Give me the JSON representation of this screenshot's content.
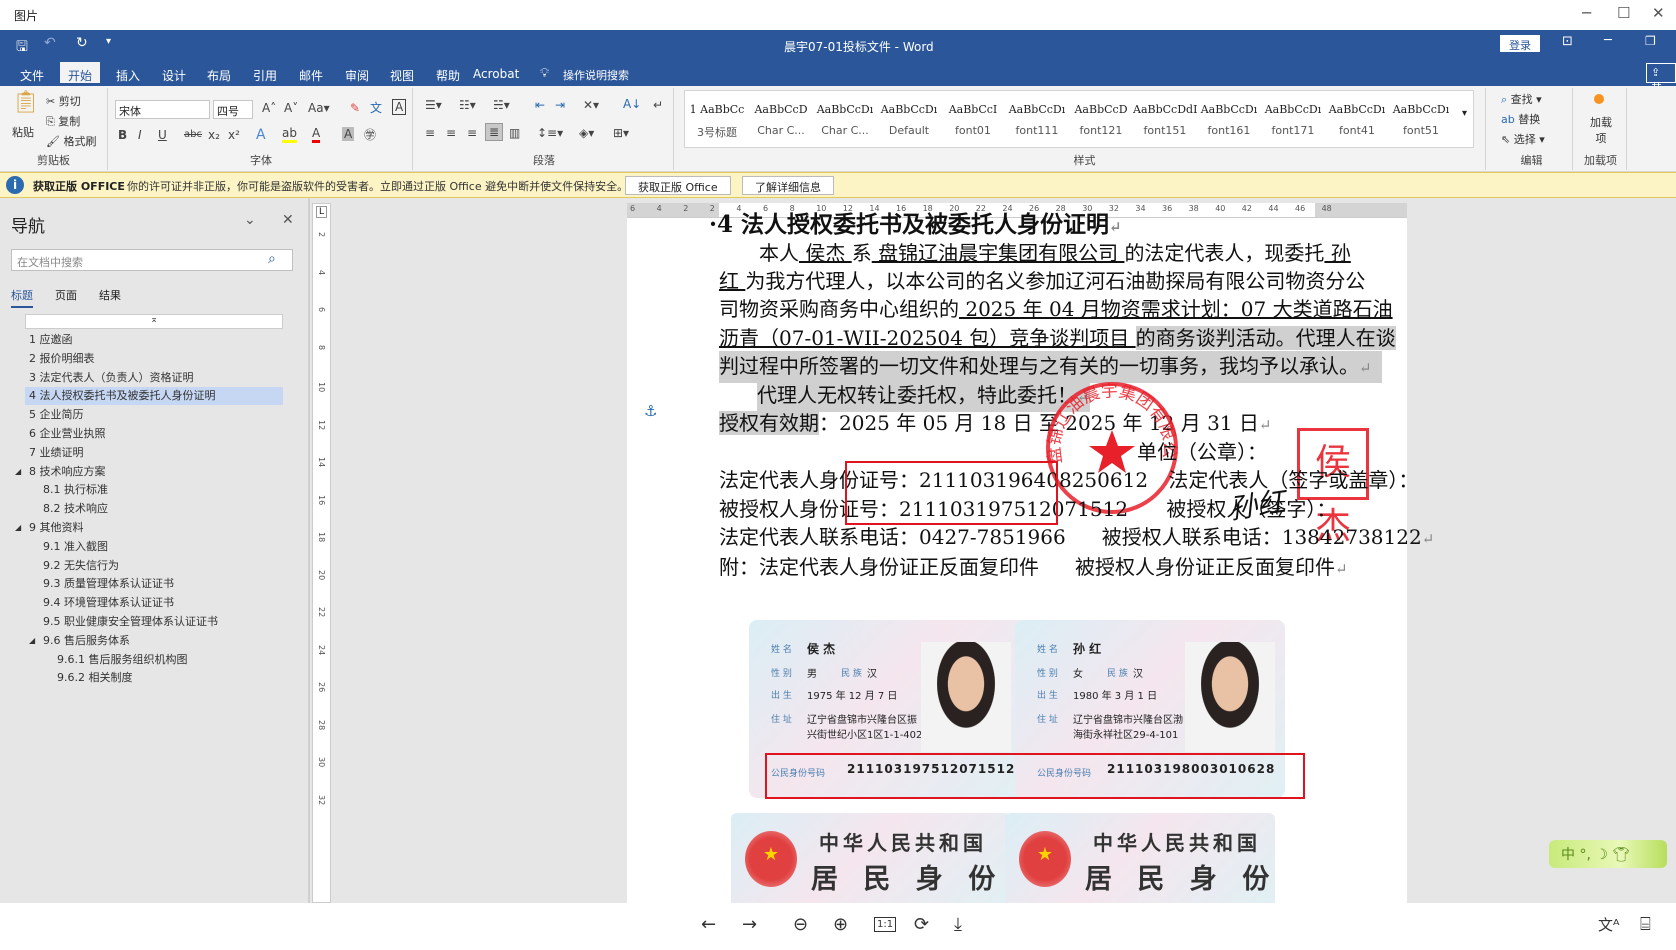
{
  "viewer": {
    "title": "图片",
    "bottom_icons": [
      "arrow-left-icon",
      "arrow-right-icon",
      "zoom-out-icon",
      "zoom-in-icon",
      "actual-size-icon",
      "rotate-icon",
      "download-icon",
      "translate-icon",
      "ocr-icon"
    ],
    "actual_size_label": "1:1"
  },
  "word": {
    "title": "晨宇07-01投标文件  -  Word",
    "login": "登录",
    "share": "共"
  },
  "menu": {
    "tabs": [
      "文件",
      "开始",
      "插入",
      "设计",
      "布局",
      "引用",
      "邮件",
      "审阅",
      "视图",
      "帮助",
      "Acrobat"
    ],
    "active": "开始",
    "tell_me": "操作说明搜索"
  },
  "ribbon": {
    "clipboard": {
      "paste": "粘贴",
      "cut": "剪切",
      "copy": "复制",
      "format_painter": "格式刷",
      "label": "剪贴板"
    },
    "font": {
      "name": "宋体",
      "size": "四号",
      "label": "字体",
      "buttons": [
        "B",
        "I",
        "U",
        "abc",
        "x₂",
        "x²"
      ]
    },
    "paragraph": {
      "label": "段落"
    },
    "styles": {
      "label": "样式",
      "items": [
        {
          "preview": "1  AaBbCc",
          "name": "3号标题"
        },
        {
          "preview": "AaBbCcD",
          "name": "Char C..."
        },
        {
          "preview": "AaBbCcDı",
          "name": "Char C..."
        },
        {
          "preview": "AaBbCcDı",
          "name": "Default"
        },
        {
          "preview": "AaBbCcI",
          "name": "font01"
        },
        {
          "preview": "AaBbCcDı",
          "name": "font111"
        },
        {
          "preview": "AaBbCcD",
          "name": "font121"
        },
        {
          "preview": "AaBbCcDdI",
          "name": "font151"
        },
        {
          "preview": "AaBbCcDı",
          "name": "font161"
        },
        {
          "preview": "AaBbCcDı",
          "name": "font171"
        },
        {
          "preview": "AaBbCcDı",
          "name": "font41"
        },
        {
          "preview": "AaBbCcDı",
          "name": "font51"
        }
      ]
    },
    "editing": {
      "find": "查找",
      "replace": "替换",
      "select": "选择",
      "label": "编辑"
    },
    "addins": {
      "button": "加载项",
      "label": "加载项"
    }
  },
  "notice": {
    "title": "获取正版 OFFICE",
    "message": "你的许可证并非正版，你可能是盗版软件的受害者。立即通过正版 Office 避免中断并使文件保持安全。",
    "btn_get": "获取正版 Office",
    "btn_learn": "了解详细信息"
  },
  "nav": {
    "title": "导航",
    "search_placeholder": "在文档中搜索",
    "tabs": [
      "标题",
      "页面",
      "结果"
    ],
    "items": [
      {
        "t": "1 应邀函",
        "l": 0
      },
      {
        "t": "2 报价明细表",
        "l": 0
      },
      {
        "t": "3 法定代表人（负责人）资格证明",
        "l": 0
      },
      {
        "t": "4 法人授权委托书及被委托人身份证明",
        "l": 0,
        "sel": true
      },
      {
        "t": "5 企业简历",
        "l": 0
      },
      {
        "t": "6 企业营业执照",
        "l": 0
      },
      {
        "t": "7 业绩证明",
        "l": 0
      },
      {
        "t": "8 技术响应方案",
        "l": 0,
        "exp": true
      },
      {
        "t": "8.1 执行标准",
        "l": 1
      },
      {
        "t": "8.2 技术响应",
        "l": 1
      },
      {
        "t": "9 其他资料",
        "l": 0,
        "exp": true
      },
      {
        "t": "9.1 准入截图",
        "l": 1
      },
      {
        "t": "9.2 无失信行为",
        "l": 1
      },
      {
        "t": "9.3 质量管理体系认证证书",
        "l": 1
      },
      {
        "t": "9.4 环境管理体系认证证书",
        "l": 1
      },
      {
        "t": "9.5 职业健康安全管理体系认证证书",
        "l": 1
      },
      {
        "t": "9.6 售后服务体系",
        "l": 1,
        "exp": true
      },
      {
        "t": "9.6.1 售后服务组织机构图",
        "l": 2
      },
      {
        "t": "9.6.2 相关制度",
        "l": 2
      }
    ]
  },
  "rulers": {
    "h": [
      "6",
      "4",
      "2",
      "2",
      "4",
      "6",
      "8",
      "10",
      "12",
      "14",
      "16",
      "18",
      "20",
      "22",
      "24",
      "26",
      "28",
      "30",
      "32",
      "34",
      "36",
      "38",
      "40",
      "42",
      "44",
      "46",
      "48"
    ],
    "v": [
      "2",
      "4",
      "6",
      "8",
      "10",
      "12",
      "14",
      "16",
      "18",
      "20",
      "22",
      "24",
      "26",
      "28",
      "30",
      "32"
    ]
  },
  "doc": {
    "heading": "4  法人授权委托书及被委托人身份证明",
    "p1a": "本人",
    "rep": " 侯杰 ",
    "p1b": "系",
    "company": " 盘锦辽油晨宇集团有限公司 ",
    "p1c": "的法定代表人，现委托",
    "agent1": " 孙",
    "agent2": "红 ",
    "p2": "为我方代理人，以本公司的名义参加辽河石油勘探局有限公司物资分公",
    "p3a": "司物资采购商务中心组织的",
    "proj1": " 2025 年 04 月物资需求计划：07 大类道路石油",
    "proj2": "沥青（07-01-WII-202504 包）竞争谈判项目 ",
    "p4": "的商务谈判活动。代理人在谈",
    "p5": "判过程中所签署的一切文件和处理与之有关的一切事务，我均予以承认。",
    "p6": "代理人无权转让委托权，特此委托！",
    "valid_label": "授权有效期",
    "valid": "：2025 年 05 月 18 日  至  2025 年 12 月 31 日",
    "unit": "单位（公章）：",
    "rep_id": "法定代表人身份证号：211103196408250612",
    "rep_sign": "法定代表人（签字或盖章）：",
    "agent_id": "被授权人身份证号：211103197512071512",
    "agent_sign": "被授权人（签字）：",
    "rep_tel": "法定代表人联系电话：0427-7851966",
    "agent_tel": "被授权人联系电话：13842738122",
    "att_rep": "附：法定代表人身份证正反面复印件",
    "att_agent": "被授权人身份证正反面复印件",
    "seal_text": "盘锦辽油晨宇集团有限公司",
    "square_seal": "侯杰",
    "signature": "孙红"
  },
  "cards": [
    {
      "name": "侯 杰",
      "sex": "男",
      "nation": "汉",
      "birth": "1975 年 12 月 7 日",
      "addr1": "辽宁省盘锦市兴隆台区振",
      "addr2": "兴街世纪小区1区1-1-402",
      "id": "211103197512071512"
    },
    {
      "name": "孙 红",
      "sex": "女",
      "nation": "汉",
      "birth": "1980 年 3 月 1 日",
      "addr1": "辽宁省盘锦市兴隆台区渤",
      "addr2": "海街永祥社区29-4-101",
      "id": "211103198003010628"
    }
  ],
  "card_labels": {
    "name": "姓 名",
    "sex": "性 别",
    "nation": "民 族",
    "birth": "出 生",
    "addr": "住 址",
    "id": "公民身份号码",
    "country": "中华人民共和国",
    "doc": "居 民 身 份 证"
  },
  "ime": {
    "label": "中"
  }
}
